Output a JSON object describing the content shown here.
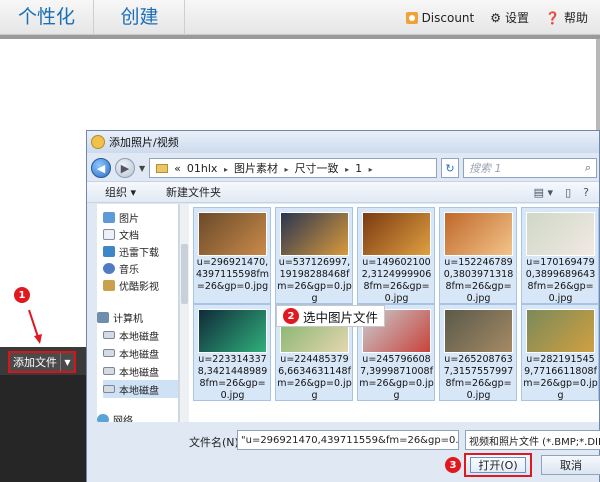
{
  "app": {
    "tabs": [
      "个性化",
      "创建"
    ],
    "right_menu": [
      {
        "icon": "discount-icon",
        "label": "Discount"
      },
      {
        "icon": "gear-icon",
        "label": "设置"
      },
      {
        "icon": "help-icon",
        "label": "帮助"
      }
    ]
  },
  "left": {
    "add_button_label": "添加文件",
    "step1": "1"
  },
  "dialog": {
    "title": "添加照片/视频",
    "breadcrumb": [
      "«",
      "01hlx",
      "图片素材",
      "尺寸一致",
      "1"
    ],
    "search_placeholder": "搜索 1",
    "toolbar": {
      "organize": "组织 ▾",
      "new_folder": "新建文件夹"
    },
    "nav_items": [
      {
        "icon": "pictures-icon",
        "label": "图片"
      },
      {
        "icon": "documents-icon",
        "label": "文档"
      },
      {
        "icon": "thunder-download-icon",
        "label": "迅雷下载"
      },
      {
        "icon": "music-icon",
        "label": "音乐"
      },
      {
        "icon": "video-icon",
        "label": "优酷影视"
      },
      {
        "icon": "computer-icon",
        "label": "计算机"
      },
      {
        "icon": "disk-icon",
        "label": "本地磁盘"
      },
      {
        "icon": "disk-icon",
        "label": "本地磁盘"
      },
      {
        "icon": "disk-icon",
        "label": "本地磁盘"
      },
      {
        "icon": "disk-icon",
        "label": "本地磁盘"
      },
      {
        "icon": "network-icon",
        "label": "网络"
      }
    ],
    "files": [
      {
        "name": "u=296921470,4397115598fm=26&gp=0.jpg",
        "colors": [
          "#6b4a2a",
          "#c98a4a"
        ]
      },
      {
        "name": "u=537126997,19198288468fm=26&gp=0.jpg",
        "colors": [
          "#2a3550",
          "#d99a3c"
        ]
      },
      {
        "name": "u=1496021002,31249999068fm=26&gp=0.jpg",
        "colors": [
          "#7a3a12",
          "#e0a040"
        ]
      },
      {
        "name": "u=1522467890,38039713188fm=26&gp=0.jpg",
        "colors": [
          "#c0682a",
          "#f3c48a"
        ]
      },
      {
        "name": "u=1701694790,38996896438fm=26&gp=0.jpg",
        "colors": [
          "#cfd8c8",
          "#f1e9e2"
        ]
      },
      {
        "name": "u=2233143378,34214489898fm=26&gp=0.jpg",
        "colors": [
          "#102a3a",
          "#2fb07a"
        ]
      },
      {
        "name": "u=2244853796,6634631148fm=26&gp=0.jpg",
        "colors": [
          "#7fb36a",
          "#e4d6b0"
        ]
      },
      {
        "name": "u=2457966087,3999871008fm=26&gp=0.jpg",
        "colors": [
          "#c9ccd1",
          "#c8433a"
        ]
      },
      {
        "name": "u=2652087637,31575579978fm=26&gp=0.jpg",
        "colors": [
          "#5a5a4a",
          "#a58a64"
        ]
      },
      {
        "name": "u=2821915459,7716611808fm=26&gp=0.jpg",
        "colors": [
          "#7a8a5a",
          "#d0a040"
        ]
      }
    ],
    "callout": {
      "step": "2",
      "text": "选中图片文件"
    },
    "filename_label": "文件名(N):",
    "filename_value": "\"u=296921470,439711559&fm=26&gp=0.jpg\"",
    "filetype_value": "视频和照片文件 (*.BMP;*.DIB;*",
    "open_label": "打开(O)",
    "cancel_label": "取消",
    "step3": "3"
  }
}
